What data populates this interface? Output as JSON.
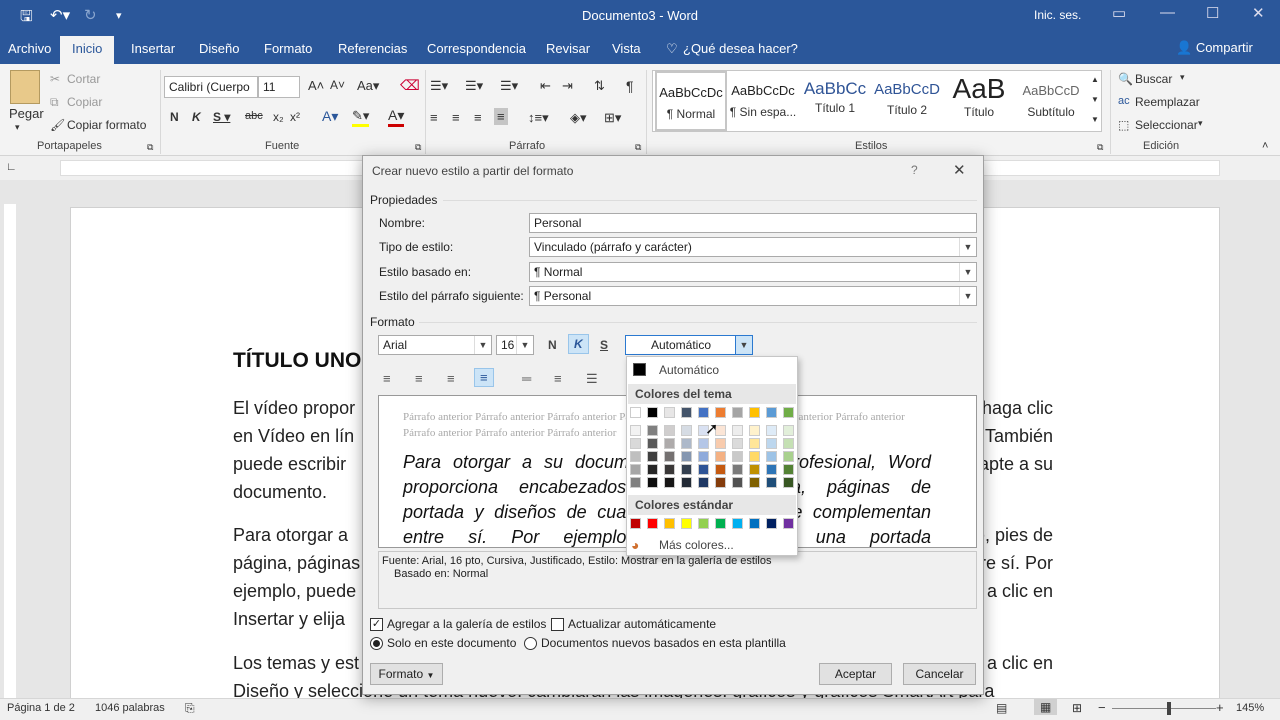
{
  "window": {
    "title": "Documento3 - Word",
    "sign_in": "Inic. ses."
  },
  "menu": {
    "items": [
      "Archivo",
      "Inicio",
      "Insertar",
      "Diseño",
      "Formato",
      "Referencias",
      "Correspondencia",
      "Revisar",
      "Vista"
    ],
    "tell_me": "¿Qué desea hacer?",
    "share": "Compartir"
  },
  "ribbon": {
    "clipboard": {
      "paste": "Pegar",
      "cut": "Cortar",
      "copy": "Copiar",
      "format_painter": "Copiar formato",
      "label": "Portapapeles"
    },
    "font": {
      "name": "Calibri (Cuerpo",
      "size": "11",
      "label": "Fuente"
    },
    "paragraph": {
      "label": "Párrafo"
    },
    "styles": {
      "label": "Estilos",
      "items": [
        {
          "preview": "AaBbCcDc",
          "name": "¶ Normal"
        },
        {
          "preview": "AaBbCcDc",
          "name": "¶ Sin espa..."
        },
        {
          "preview": "AaBbCc",
          "name": "Título 1"
        },
        {
          "preview": "AaBbCcD",
          "name": "Título 2"
        },
        {
          "preview": "AaB",
          "name": "Título"
        },
        {
          "preview": "AaBbCcD",
          "name": "Subtítulo"
        }
      ]
    },
    "editing": {
      "find": "Buscar",
      "replace": "Reemplazar",
      "select": "Seleccionar",
      "label": "Edición"
    }
  },
  "document": {
    "heading": "TÍTULO UNO",
    "lines": [
      "El vídeo propor",
      "en Vídeo en lín",
      "puede escribir",
      "documento.",
      "Para otorgar a",
      "página, páginas",
      "ejemplo, puede",
      "Insertar y elija",
      "Los temas y est",
      "Diseño y seleccione un tema nuevo. cambiarán las imágenes. gráficos y gráficos SmartArt para"
    ],
    "right_lines": [
      "haga clic",
      "También",
      "apte a su",
      "",
      "do, pies de",
      "re sí. Por",
      "a clic en",
      "",
      "a clic en",
      ""
    ]
  },
  "dialog": {
    "title": "Crear nuevo estilo a partir del formato",
    "properties_label": "Propiedades",
    "name_label": "Nombre:",
    "name_value": "Personal",
    "type_label": "Tipo de estilo:",
    "type_value": "Vinculado (párrafo y carácter)",
    "based_label": "Estilo basado en:",
    "based_value": "¶  Normal",
    "next_label": "Estilo del párrafo siguiente:",
    "next_value": "¶  Personal",
    "format_label": "Formato",
    "font": "Arial",
    "size": "16",
    "bold": "N",
    "italic": "K",
    "underline": "S",
    "color": "Automático",
    "preview_prev": "Párrafo anterior Párrafo anterior Párrafo anterior Párrafo anterior Párrafo anterior Párrafo anterior Párrafo anterior Párrafo anterior Párrafo anterior Párrafo anterior",
    "preview_prev2": "Párrafo anterior Párrafo anterior Párrafo",
    "preview_sample": [
      "Para otorgar a su documento un aspecto profesional, Word",
      "proporciona encabezados, pies de página, páginas de",
      "portada y diseños de cuadro de texto que se complementan",
      "entre sí. Por ejemplo, puede agregar una portada"
    ],
    "description": "Fuente: Arial, 16 pto, Cursiva, Justificado, Estilo: Mostrar en la galería de estilos",
    "description2": "Basado en: Normal",
    "add_gallery": "Agregar a la galería de estilos",
    "auto_update": "Actualizar automáticamente",
    "only_doc": "Solo en este documento",
    "new_docs": "Documentos nuevos basados en esta plantilla",
    "format_btn": "Formato",
    "ok": "Aceptar",
    "cancel": "Cancelar"
  },
  "palette": {
    "automatic": "Automático",
    "theme_label": "Colores del tema",
    "standard_label": "Colores estándar",
    "more": "Más colores...",
    "theme_top": [
      "#ffffff",
      "#000000",
      "#e7e6e6",
      "#44546a",
      "#4472c4",
      "#ed7d31",
      "#a5a5a5",
      "#ffc000",
      "#5b9bd5",
      "#70ad47"
    ],
    "theme_cols": [
      [
        "#f2f2f2",
        "#d9d9d9",
        "#bfbfbf",
        "#a6a6a6",
        "#808080"
      ],
      [
        "#808080",
        "#595959",
        "#404040",
        "#262626",
        "#0d0d0d"
      ],
      [
        "#d0cece",
        "#aeabab",
        "#757171",
        "#3a3838",
        "#171616"
      ],
      [
        "#d6dce4",
        "#adb9ca",
        "#8496b0",
        "#333f4f",
        "#222a35"
      ],
      [
        "#d9e1f2",
        "#b4c6e7",
        "#8eaadb",
        "#2f5496",
        "#1f3864"
      ],
      [
        "#fbe5d6",
        "#f8cbad",
        "#f4b183",
        "#c55a11",
        "#843c0c"
      ],
      [
        "#ededed",
        "#dbdbdb",
        "#c9c9c9",
        "#7b7b7b",
        "#525252"
      ],
      [
        "#fff2cc",
        "#ffe699",
        "#ffd966",
        "#bf9000",
        "#7f6000"
      ],
      [
        "#deebf7",
        "#bdd7ee",
        "#9dc3e6",
        "#2e75b6",
        "#1f4e79"
      ],
      [
        "#e2efda",
        "#c5e0b4",
        "#a9d18e",
        "#548235",
        "#385723"
      ]
    ],
    "standard": [
      "#c00000",
      "#ff0000",
      "#ffc000",
      "#ffff00",
      "#92d050",
      "#00b050",
      "#00b0f0",
      "#0070c0",
      "#002060",
      "#7030a0"
    ]
  },
  "status": {
    "page": "Página 1 de 2",
    "words": "1046 palabras",
    "zoom": "145%"
  }
}
